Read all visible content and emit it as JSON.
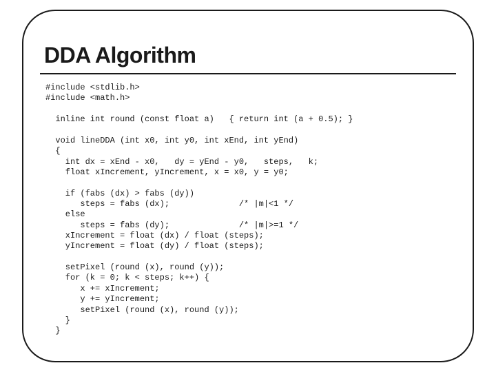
{
  "title": "DDA Algorithm",
  "code": "#include <stdlib.h>\n#include <math.h>\n\n  inline int round (const float a)   { return int (a + 0.5); }\n\n  void lineDDA (int x0, int y0, int xEnd, int yEnd)\n  {\n    int dx = xEnd - x0,   dy = yEnd - y0,   steps,   k;\n    float xIncrement, yIncrement, x = x0, y = y0;\n\n    if (fabs (dx) > fabs (dy))\n       steps = fabs (dx);              /* |m|<1 */\n    else\n       steps = fabs (dy);              /* |m|>=1 */\n    xIncrement = float (dx) / float (steps);\n    yIncrement = float (dy) / float (steps);\n\n    setPixel (round (x), round (y));\n    for (k = 0; k < steps; k++) {\n       x += xIncrement;\n       y += yIncrement;\n       setPixel (round (x), round (y));\n    }\n  }"
}
